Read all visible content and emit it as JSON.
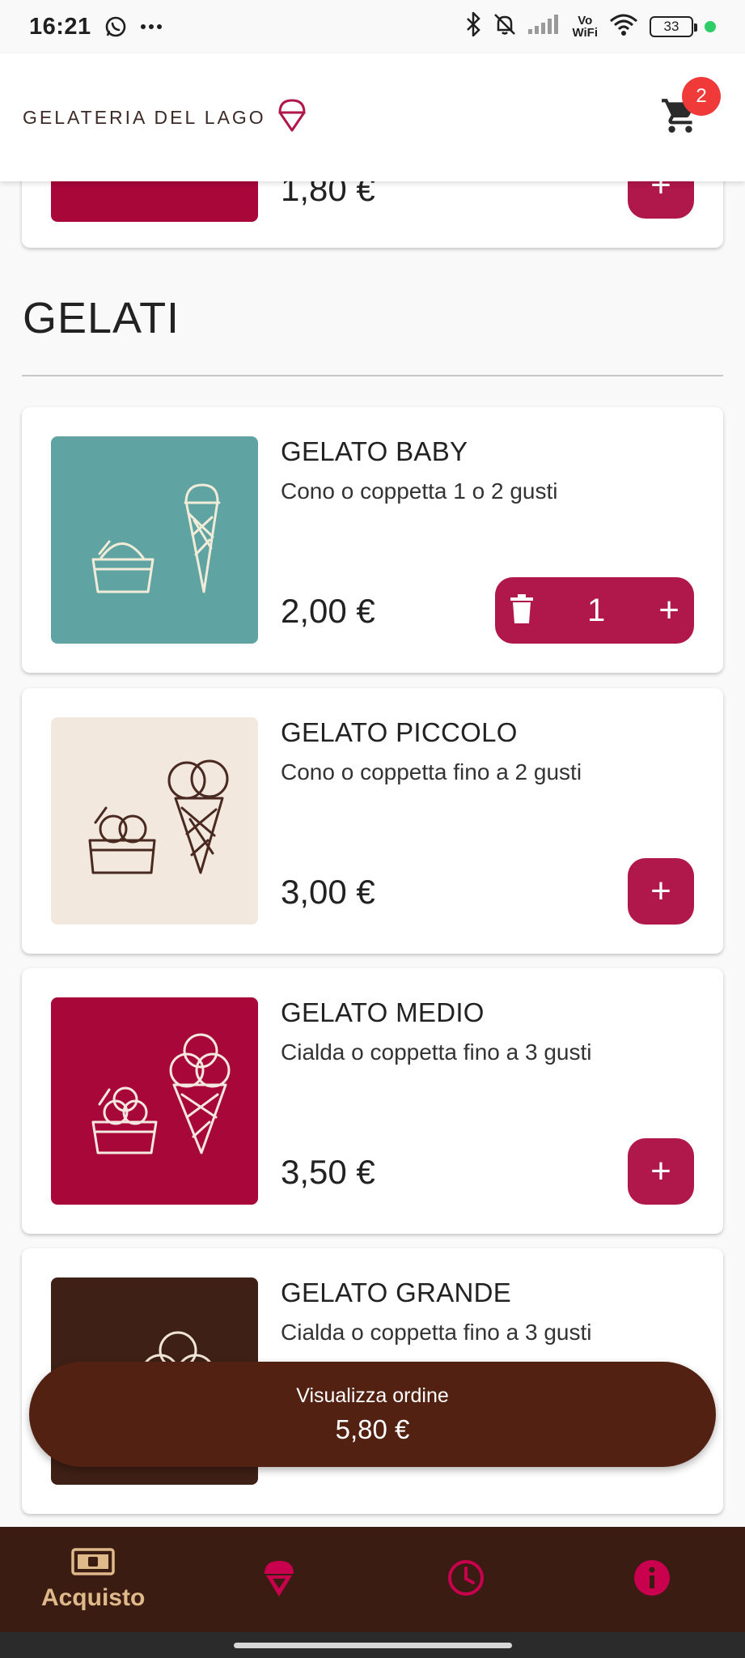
{
  "status_bar": {
    "time": "16:21",
    "vowifi_top": "Vo",
    "vowifi_bottom": "WiFi",
    "battery": "33"
  },
  "app_bar": {
    "brand_name": "GELATERIA DEL LAGO",
    "cart_count": "2"
  },
  "previous_item": {
    "price": "1,80 €",
    "image_color": "#a8073a"
  },
  "section": {
    "title": "GELATI"
  },
  "products": [
    {
      "name": "GELATO BABY",
      "description": "Cono o coppetta 1 o 2 gusti",
      "price": "2,00 €",
      "image_color": "#5fa3a3",
      "quantity": "1"
    },
    {
      "name": "GELATO PICCOLO",
      "description": "Cono o coppetta fino a 2 gusti",
      "price": "3,00 €",
      "image_color": "#f2e8de"
    },
    {
      "name": "GELATO MEDIO",
      "description": "Cialda o coppetta fino a 3 gusti",
      "price": "3,50 €",
      "image_color": "#a8073a"
    },
    {
      "name": "GELATO GRANDE",
      "description": "Cialda o coppetta fino a 3 gusti",
      "image_color": "#3e2016"
    }
  ],
  "order_button": {
    "label": "Visualizza ordine",
    "total": "5,80 €"
  },
  "bottom_nav": {
    "items": [
      {
        "label": "Acquisto",
        "icon": "cash-icon",
        "active": true
      },
      {
        "label": "",
        "icon": "ice-cream-icon",
        "active": false
      },
      {
        "label": "",
        "icon": "clock-icon",
        "active": false
      },
      {
        "label": "",
        "icon": "info-icon",
        "active": false
      }
    ]
  },
  "colors": {
    "accent": "#b0174a",
    "order_button": "#532112",
    "nav_background": "#3a1c12",
    "nav_active": "#e0b98a",
    "badge": "#f03a3a"
  }
}
